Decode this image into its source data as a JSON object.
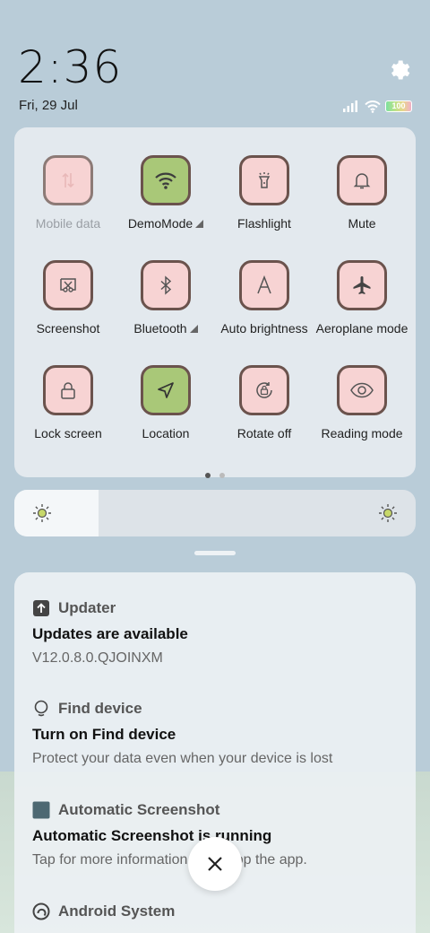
{
  "status": {
    "time": "2:36",
    "date": "Fri, 29 Jul",
    "battery": "100"
  },
  "tiles": [
    {
      "label": "Mobile data",
      "icon": "mobile-data-icon",
      "state": "unavailable"
    },
    {
      "label": "DemoMode",
      "icon": "wifi-icon",
      "state": "on"
    },
    {
      "label": "Flashlight",
      "icon": "flashlight-icon",
      "state": "off"
    },
    {
      "label": "Mute",
      "icon": "bell-icon",
      "state": "off"
    },
    {
      "label": "Screenshot",
      "icon": "screenshot-icon",
      "state": "off"
    },
    {
      "label": "Bluetooth",
      "icon": "bluetooth-icon",
      "state": "off"
    },
    {
      "label": "Auto brightness",
      "icon": "auto-brightness-icon",
      "state": "off"
    },
    {
      "label": "Aeroplane mode",
      "icon": "airplane-icon",
      "state": "off"
    },
    {
      "label": "Lock screen",
      "icon": "lock-icon",
      "state": "off"
    },
    {
      "label": "Location",
      "icon": "location-arrow-icon",
      "state": "on"
    },
    {
      "label": "Rotate off",
      "icon": "rotate-lock-icon",
      "state": "off"
    },
    {
      "label": "Reading mode",
      "icon": "eye-icon",
      "state": "off"
    }
  ],
  "qs_pages": {
    "count": 2,
    "current": 1
  },
  "brightness": {
    "level": 0.21
  },
  "notifications": [
    {
      "app": "Updater",
      "icon": "updater-icon",
      "title": "Updates are available",
      "text": "V12.0.8.0.QJOINXM"
    },
    {
      "app": "Find device",
      "icon": "find-device-icon",
      "title": "Turn on Find device",
      "text": "Protect your data even when your device is lost"
    },
    {
      "app": "Automatic Screenshot",
      "icon": "screenshot-app-icon",
      "title": "Automatic Screenshot is running",
      "text": "Tap for more information or to stop the app."
    },
    {
      "app": "Android System",
      "icon": "android-system-icon",
      "title": "",
      "text": ""
    }
  ],
  "colors": {
    "tile_off": "#f7d3d3",
    "tile_on": "#a9c878",
    "tile_border": "#6b534d",
    "background": "#b9ccd8"
  }
}
